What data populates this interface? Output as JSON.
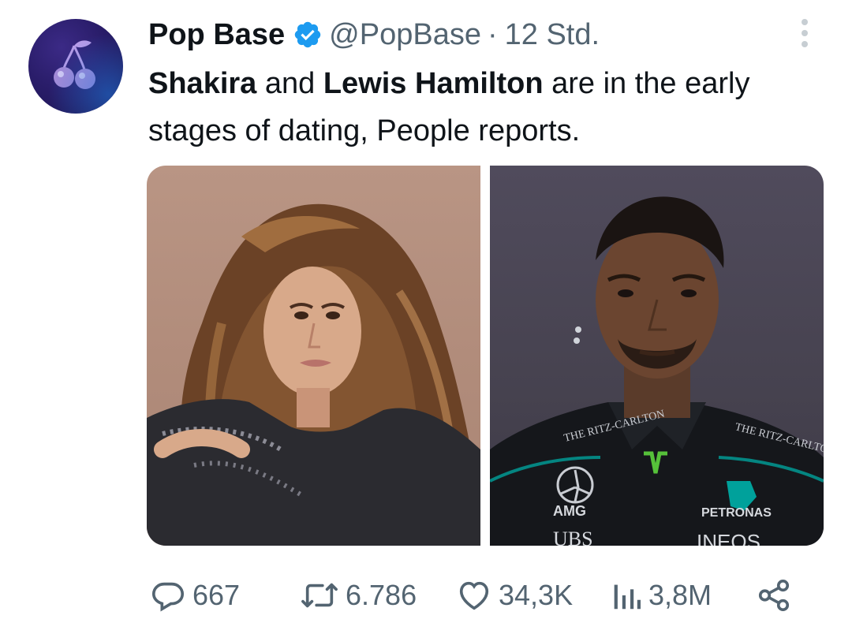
{
  "tweet": {
    "author_name": "Pop Base",
    "handle": "@PopBase",
    "separator": "·",
    "time": "12 Std.",
    "text_bold_1": "Shakira",
    "text_plain_1": " and ",
    "text_bold_2": "Lewis Hamilton",
    "text_plain_2": " are in the early stages of dating, People reports."
  },
  "media": {
    "left_photo": {
      "subject": "Shakira portrait",
      "caption_visible": false
    },
    "right_photo": {
      "subject": "Lewis Hamilton portrait",
      "suit_texts": [
        "THE RITZ-CARLTON",
        "THE RITZ-CARLTON",
        "AMG",
        "PETRONAS",
        "UBS",
        "INEOS"
      ]
    }
  },
  "stats": {
    "replies": "667",
    "reposts": "6.786",
    "likes": "34,3K",
    "views": "3,8M"
  },
  "icons": {
    "verified": "verified-badge-icon",
    "more": "more-vertical-icon",
    "reply": "reply-icon",
    "repost": "repost-icon",
    "like": "heart-icon",
    "views": "views-icon",
    "share": "share-icon"
  },
  "colors": {
    "text": "#0f1419",
    "secondary": "#536471",
    "verified_blue": "#1d9bf0",
    "avatar_bg": "#2a1d6a"
  }
}
